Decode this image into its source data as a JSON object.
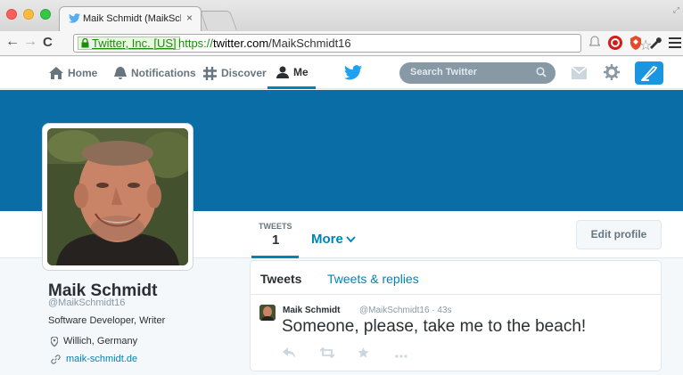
{
  "browser": {
    "tab_title": "Maik Schmidt (MaikSchmid",
    "tab_close": "×",
    "cert_label": "Twitter, Inc. [US]",
    "url_scheme": "https://",
    "url_host": "twitter.com",
    "url_path": "/MaikSchmidt16"
  },
  "nav": {
    "home": "Home",
    "notifications": "Notifications",
    "discover": "Discover",
    "me": "Me",
    "search_placeholder": "Search Twitter"
  },
  "profile": {
    "name": "Maik Schmidt",
    "handle": "@MaikSchmidt16",
    "bio": "Software Developer, Writer",
    "location": "Willich, Germany",
    "website": "maik-schmidt.de",
    "stats_label": "TWEETS",
    "stats_value": "1",
    "more_label": "More",
    "edit_profile": "Edit profile"
  },
  "timeline": {
    "tab_tweets": "Tweets",
    "tab_replies": "Tweets & replies",
    "tweet": {
      "author": "Maik Schmidt",
      "meta": "@MaikSchmidt16 · 43s",
      "text": "Someone, please, take me to the beach!"
    }
  },
  "colors": {
    "banner": "#0b6da6",
    "link": "#0084b4",
    "compose": "#1b95e0"
  }
}
